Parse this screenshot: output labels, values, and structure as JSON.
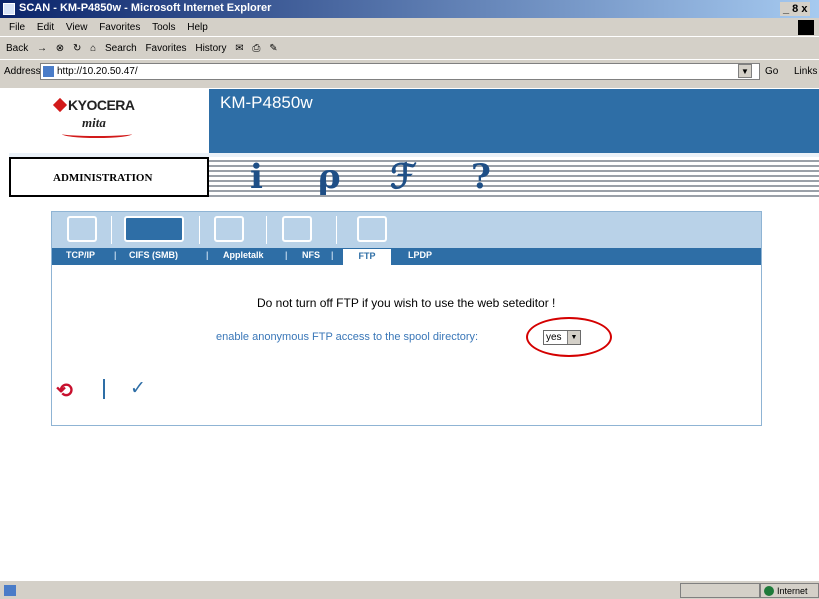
{
  "window": {
    "title": "SCAN - KM-P4850w - Microsoft Internet Explorer",
    "controls": "_ 8 x"
  },
  "menu": [
    "File",
    "Edit",
    "View",
    "Favorites",
    "Tools",
    "Help"
  ],
  "toolbar": [
    "Back",
    "Search",
    "Favorites",
    "History"
  ],
  "address": {
    "label": "Address",
    "url": "http://10.20.50.47/",
    "go": "Go",
    "links": "Links"
  },
  "header": {
    "brand": "KYOCERA",
    "brand_sub": "mita",
    "model": "KM-P4850w"
  },
  "nav": {
    "section_label": "ADMINISTRATION",
    "icons": [
      "info-icon",
      "search-key-icon",
      "tools-wrench-icon",
      "help-question-icon"
    ]
  },
  "tabs": [
    "TCP/IP",
    "CIFS (SMB)",
    "Appletalk",
    "NFS",
    "FTP",
    "LPDP"
  ],
  "active_tab": "FTP",
  "content": {
    "message": "Do not turn off FTP if you wish to use the web seteditor !",
    "anon_label": "enable anonymous FTP access to the spool directory:",
    "anon_value": "yes"
  },
  "actions": {
    "undo_icon": "undo-icon",
    "submit_icon": "check-icon"
  },
  "status": {
    "zone": "Internet"
  },
  "colors": {
    "brand_blue": "#2e6ea6",
    "light_blue": "#b9d2e8",
    "highlight_red": "#d40000"
  }
}
